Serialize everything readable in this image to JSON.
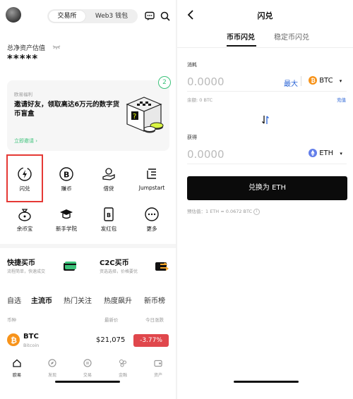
{
  "left": {
    "segment": {
      "active": "交易所",
      "inactive": "Web3 钱包"
    },
    "assets": {
      "label": "总净资产估值",
      "value": "*****"
    },
    "promo": {
      "tag": "欧易福利",
      "title_line1": "邀请好友，领取高达6万元的数字货",
      "title_line2": "币盲盒",
      "link": "立即邀请",
      "badge": "2"
    },
    "grid": [
      {
        "label": "闪兑",
        "icon": "flash-swap-icon"
      },
      {
        "label": "赚币",
        "icon": "earn-coin-icon"
      },
      {
        "label": "借贷",
        "icon": "loan-hand-icon"
      },
      {
        "label": "Jumpstart",
        "icon": "jumpstart-icon"
      },
      {
        "label": "余币宝",
        "icon": "savings-bag-icon"
      },
      {
        "label": "新手学院",
        "icon": "graduation-cap-icon"
      },
      {
        "label": "发红包",
        "icon": "red-packet-icon"
      },
      {
        "label": "更多",
        "icon": "more-dots-icon"
      }
    ],
    "quick": [
      {
        "title": "快捷买币",
        "sub": "流程简单，快速成交"
      },
      {
        "title": "C2C买币",
        "sub": "资选选择，价格要优"
      }
    ],
    "market_tabs": [
      "自选",
      "主流币",
      "热门关注",
      "热度飙升",
      "新币榜"
    ],
    "market_active": "主流币",
    "table_header": {
      "coin": "币种",
      "price": "最新价",
      "change": "今日涨跌"
    },
    "row": {
      "symbol": "BTC",
      "name": "Bitcoin",
      "price": "$21,075",
      "change": "-3.77%"
    },
    "bottom_nav": [
      "欧易",
      "发现",
      "交易",
      "金融",
      "资产"
    ],
    "colors": {
      "accent": "#3cc27a",
      "highlight": "#e53935",
      "down": "#e0474c",
      "btc": "#f7931a"
    }
  },
  "right": {
    "title": "闪兑",
    "tabs": [
      "币币闪兑",
      "稳定币闪兑"
    ],
    "active_tab": "币币闪兑",
    "spend": {
      "label": "消耗",
      "amount": "0.0000",
      "max": "最大",
      "coin": "BTC",
      "balance": "余额: 0 BTC",
      "recharge": "充值"
    },
    "receive": {
      "label": "获得",
      "amount": "0.0000",
      "coin": "ETH"
    },
    "button": "兑换为 ETH",
    "rate": "预估值：1 ETH ≈ 0.0672 BTC",
    "colors": {
      "accent": "#2a64d6",
      "eth": "#627eea"
    }
  }
}
